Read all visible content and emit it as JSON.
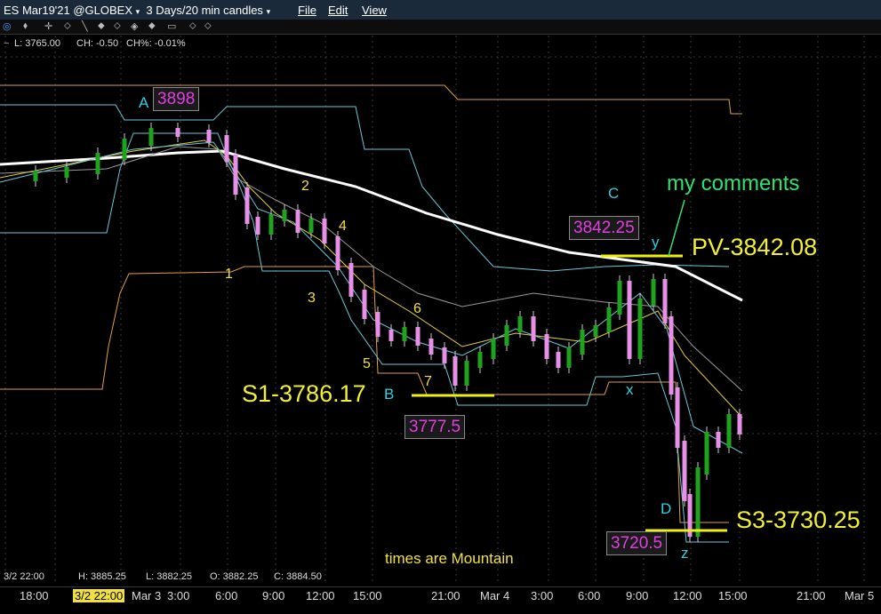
{
  "window": {
    "contract": "ES Mar19'21 @GLOBEX",
    "period": "3 Days/20 min candles",
    "menus": [
      "File",
      "Edit",
      "View"
    ]
  },
  "toolbar": {
    "icons": [
      "zoom-icon",
      "pan-icon",
      "crosshair-icon",
      "draw-icon",
      "line-icon",
      "fib-icon",
      "text-icon",
      "measure-icon",
      "delete-icon",
      "settings-icon"
    ]
  },
  "info": {
    "last": "L: 3765.00",
    "change": "CH: -0.50",
    "change_pct": "CH%: -0.01%"
  },
  "ohlc": {
    "time": "3/2 22:00",
    "high": "H: 3885.25",
    "low": "L: 3882.25",
    "open": "O: 3882.25",
    "close": "C: 3884.50"
  },
  "time_axis": {
    "labels": [
      "18:00",
      "3/2 22:00",
      "Mar 3",
      "3:00",
      "6:00",
      "9:00",
      "12:00",
      "15:00",
      "21:00",
      "Mar 4",
      "3:00",
      "6:00",
      "9:00",
      "12:00",
      "15:00",
      "21:00",
      "Mar 5"
    ],
    "highlighted": "3/2 22:00"
  },
  "annotations": {
    "A": "A",
    "B": "B",
    "C": "C",
    "D": "D",
    "x": "x",
    "y": "y",
    "z": "z",
    "w1": "1",
    "w2": "2",
    "w3": "3",
    "w4": "4",
    "w5": "5",
    "w6": "6",
    "w7": "7",
    "price_A": "3898",
    "price_B": "3777.5",
    "price_C": "3842.25",
    "price_D": "3720.5",
    "s1": "S1-3786.17",
    "pv": "PV-3842.08",
    "s3": "S3-3730.25",
    "my_comments": "my comments",
    "times_note": "times are Mountain"
  },
  "colors": {
    "up_candle": "#1fa31f",
    "down_candle": "#e890e8",
    "level_line": "#f0f010",
    "ma_white": "#ffffff",
    "band_orange": "#e0a040",
    "band_cyan": "#6cc8d8",
    "ma_yellow": "#e8d040",
    "ma_gray": "#9a9a9a",
    "label_magenta": "#e040e0",
    "label_cyan": "#30d0e0",
    "label_green": "#30e070"
  }
}
